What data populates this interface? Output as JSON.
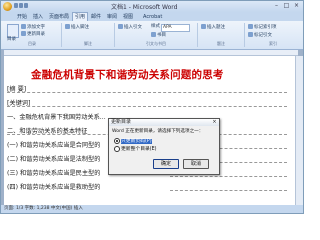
{
  "window": {
    "title": "文档1 - Microsoft Word",
    "minimize": "–",
    "maximize": "□",
    "close": "×"
  },
  "ribbon": {
    "tabs": [
      "开始",
      "插入",
      "页面布局",
      "引用",
      "邮件",
      "审阅",
      "视图",
      "Acrobat"
    ],
    "active_tab_index": 3,
    "toc_label": "目录",
    "add_text": "添加文字",
    "update_toc": "更新目录",
    "insert_footnote": "插入脚注",
    "insert_citation": "插入引文",
    "style_label": "样式",
    "style_value": "APA",
    "bibliography": "书目",
    "insert_caption": "插入题注",
    "mark_entry": "标记索引项",
    "mark_citation": "标记引文",
    "group_toc": "目录",
    "group_footnotes": "脚注",
    "group_citations": "引文与书目",
    "group_captions": "题注",
    "group_index": "索引"
  },
  "document": {
    "title": "金融危机背景下和谐劳动关系问题的思考",
    "lines": [
      "[摘 要]",
      "[关键词]",
      "一、金融危机背景下我国劳动关系...",
      "二、和谐劳动关系的基本特征",
      "(一) 和谐劳动关系应当是合同型的",
      "(二) 和谐劳动关系应当是法制型的",
      "(三) 和谐劳动关系应当是民主型的",
      "(四) 和谐劳动关系应当是救助型的"
    ]
  },
  "dialog": {
    "title": "更新目录",
    "message": "Word 正在更新目录，请选择下列选项之一：",
    "option_page_numbers": "只更新页码(P)",
    "option_entire": "更新整个目录(E)",
    "selected_option": "page_numbers",
    "ok": "确定",
    "cancel": "取消",
    "close": "×"
  },
  "status": {
    "text": "页面: 1/3   字数: 1,238   中文(中国)   插入"
  },
  "colors": {
    "title_red": "#cc0000",
    "ribbon_blue": "#c4d7ee"
  }
}
